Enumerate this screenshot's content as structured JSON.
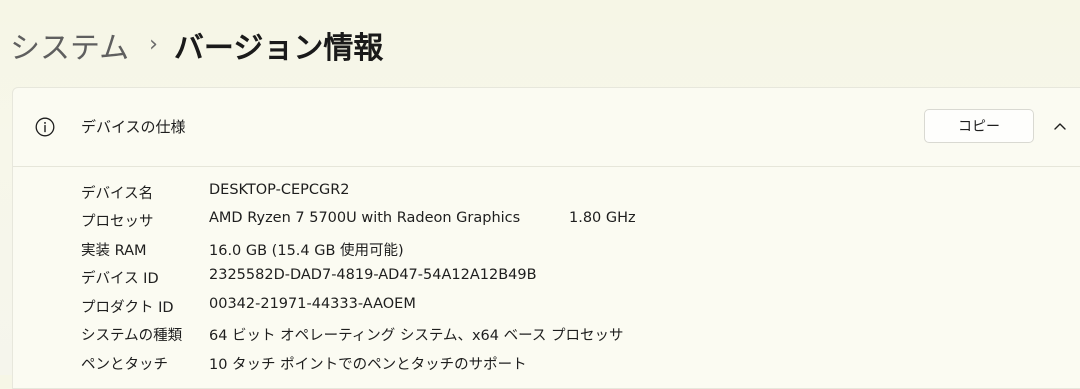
{
  "breadcrumb": {
    "parent": "システム",
    "separator": "›",
    "current": "バージョン情報"
  },
  "device_specs": {
    "title": "デバイスの仕様",
    "copy_label": "コピー",
    "rows": [
      {
        "label": "デバイス名",
        "value": "DESKTOP-CEPCGR2",
        "extra": ""
      },
      {
        "label": "プロセッサ",
        "value": "AMD Ryzen 7 5700U with Radeon Graphics",
        "extra": "1.80 GHz"
      },
      {
        "label": "実装 RAM",
        "value": "16.0 GB (15.4 GB 使用可能)",
        "extra": ""
      },
      {
        "label": "デバイス ID",
        "value": "2325582D-DAD7-4819-AD47-54A12A12B49B",
        "extra": ""
      },
      {
        "label": "プロダクト ID",
        "value": "00342-21971-44333-AAOEM",
        "extra": ""
      },
      {
        "label": "システムの種類",
        "value": "64 ビット オペレーティング システム、x64 ベース プロセッサ",
        "extra": ""
      },
      {
        "label": "ペンとタッチ",
        "value": "10 タッチ ポイントでのペンとタッチのサポート",
        "extra": ""
      }
    ]
  },
  "icons": {
    "info": "info-icon",
    "collapse": "chevron-up-icon"
  },
  "colors": {
    "background": "#f6f6e6",
    "panel": "#fbfbf2",
    "text": "#1b1b1b"
  }
}
